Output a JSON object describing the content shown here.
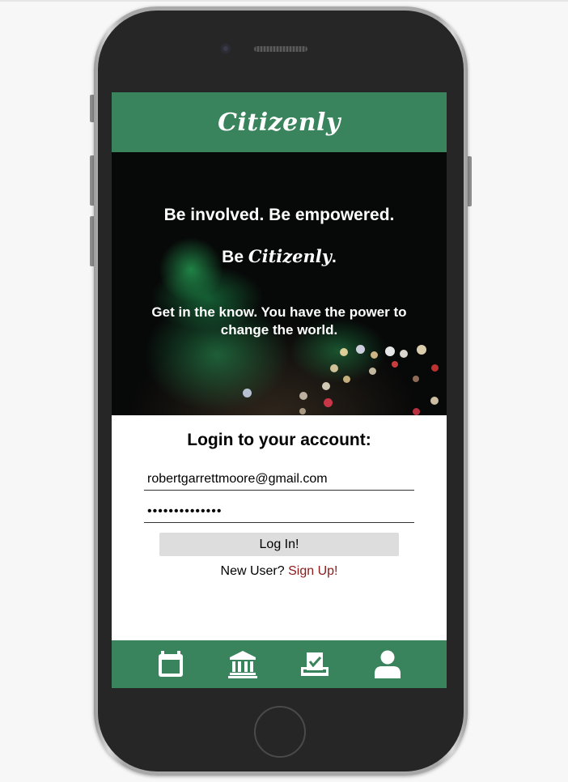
{
  "app": {
    "brand": "Citizenly",
    "colors": {
      "primary_green": "#3a845d",
      "link_red": "#8b1a1a",
      "button_gray": "#dddddd"
    }
  },
  "hero": {
    "headline": "Be involved. Be empowered.",
    "brand_prefix": "Be",
    "brand_name": "Citizenly",
    "brand_suffix": ".",
    "tagline": "Get in the know. You have the power to change the world."
  },
  "login": {
    "title": "Login to your account:",
    "email_value": "robertgarrettmoore@gmail.com",
    "password_value": "••••••••••••••",
    "button_label": "Log In!",
    "new_user_text": "New User?",
    "signup_link": "Sign Up!"
  },
  "tab_bar": {
    "items": [
      {
        "icon": "calendar-icon"
      },
      {
        "icon": "government-building-icon"
      },
      {
        "icon": "ballot-box-icon"
      },
      {
        "icon": "user-icon"
      }
    ]
  }
}
